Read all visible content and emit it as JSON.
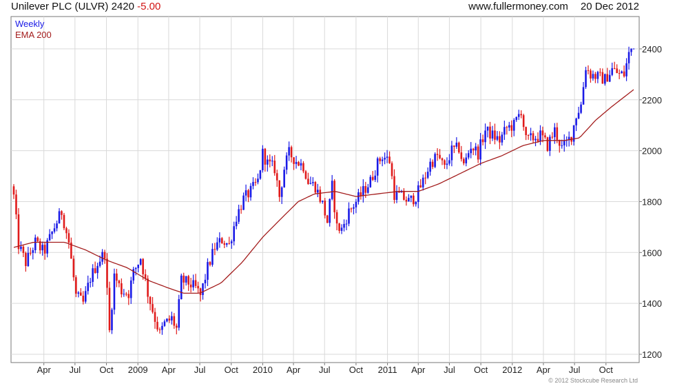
{
  "header": {
    "title": "Unilever PLC (ULVR) 2420",
    "change": "-5.00",
    "site": "www.fullermoney.com",
    "date": "20 Dec 2012"
  },
  "copyright": "© 2012 Stockcube Research Ltd",
  "colors": {
    "up": "#1a1ae6",
    "down": "#e01b1b",
    "ema": "#a31c1c",
    "grid": "#d9d9d9",
    "axis": "#777777"
  },
  "chart_data": {
    "type": "candlestick",
    "legend": [
      {
        "name": "Weekly",
        "color": "#1a1ae6"
      },
      {
        "name": "EMA 200",
        "color": "#a31c1c"
      }
    ],
    "y_axis": {
      "min": 1200,
      "max": 2500,
      "ticks": [
        1200,
        1400,
        1600,
        1800,
        2000,
        2200,
        2400
      ],
      "position": "right"
    },
    "x_axis": {
      "start": "2008-01-04",
      "end": "2012-12-21",
      "ticks": [
        {
          "label": "Apr",
          "date": "2008-04-01"
        },
        {
          "label": "Jul",
          "date": "2008-07-01"
        },
        {
          "label": "Oct",
          "date": "2008-10-01"
        },
        {
          "label": "2009",
          "date": "2009-01-01"
        },
        {
          "label": "Apr",
          "date": "2009-04-01"
        },
        {
          "label": "Jul",
          "date": "2009-07-01"
        },
        {
          "label": "Oct",
          "date": "2009-10-01"
        },
        {
          "label": "2010",
          "date": "2010-01-01"
        },
        {
          "label": "Apr",
          "date": "2010-04-01"
        },
        {
          "label": "Jul",
          "date": "2010-07-01"
        },
        {
          "label": "Oct",
          "date": "2010-10-01"
        },
        {
          "label": "2011",
          "date": "2011-01-01"
        },
        {
          "label": "Apr",
          "date": "2011-04-01"
        },
        {
          "label": "Jul",
          "date": "2011-07-01"
        },
        {
          "label": "Oct",
          "date": "2011-10-01"
        },
        {
          "label": "2012",
          "date": "2012-01-01"
        },
        {
          "label": "Apr",
          "date": "2012-04-01"
        },
        {
          "label": "Jul",
          "date": "2012-07-01"
        },
        {
          "label": "Oct",
          "date": "2012-10-01"
        }
      ]
    },
    "price_path": [
      [
        "2008-01-04",
        1820
      ],
      [
        "2008-01-18",
        1630
      ],
      [
        "2008-02-08",
        1560
      ],
      [
        "2008-03-07",
        1640
      ],
      [
        "2008-04-01",
        1600
      ],
      [
        "2008-05-02",
        1700
      ],
      [
        "2008-05-23",
        1760
      ],
      [
        "2008-06-13",
        1640
      ],
      [
        "2008-07-04",
        1430
      ],
      [
        "2008-07-25",
        1400
      ],
      [
        "2008-08-15",
        1500
      ],
      [
        "2008-09-05",
        1560
      ],
      [
        "2008-09-26",
        1600
      ],
      [
        "2008-10-10",
        1290
      ],
      [
        "2008-10-24",
        1510
      ],
      [
        "2008-11-14",
        1450
      ],
      [
        "2008-12-05",
        1440
      ],
      [
        "2008-12-19",
        1520
      ],
      [
        "2009-01-09",
        1580
      ],
      [
        "2009-01-30",
        1440
      ],
      [
        "2009-02-20",
        1340
      ],
      [
        "2009-03-06",
        1280
      ],
      [
        "2009-03-20",
        1320
      ],
      [
        "2009-04-10",
        1340
      ],
      [
        "2009-04-24",
        1300
      ],
      [
        "2009-05-08",
        1490
      ],
      [
        "2009-05-29",
        1480
      ],
      [
        "2009-06-19",
        1460
      ],
      [
        "2009-07-03",
        1430
      ],
      [
        "2009-07-24",
        1540
      ],
      [
        "2009-08-14",
        1620
      ],
      [
        "2009-09-04",
        1650
      ],
      [
        "2009-09-25",
        1630
      ],
      [
        "2009-10-16",
        1740
      ],
      [
        "2009-11-06",
        1810
      ],
      [
        "2009-11-27",
        1840
      ],
      [
        "2009-12-18",
        1880
      ],
      [
        "2010-01-01",
        1990
      ],
      [
        "2010-01-15",
        1950
      ],
      [
        "2010-02-05",
        1930
      ],
      [
        "2010-02-19",
        1820
      ],
      [
        "2010-03-05",
        1930
      ],
      [
        "2010-03-19",
        1990
      ],
      [
        "2010-04-09",
        1960
      ],
      [
        "2010-04-30",
        1940
      ],
      [
        "2010-05-14",
        1880
      ],
      [
        "2010-06-04",
        1860
      ],
      [
        "2010-06-25",
        1790
      ],
      [
        "2010-07-09",
        1720
      ],
      [
        "2010-07-23",
        1860
      ],
      [
        "2010-08-06",
        1700
      ],
      [
        "2010-08-20",
        1690
      ],
      [
        "2010-09-10",
        1760
      ],
      [
        "2010-10-01",
        1800
      ],
      [
        "2010-10-22",
        1840
      ],
      [
        "2010-11-12",
        1880
      ],
      [
        "2010-12-03",
        1950
      ],
      [
        "2010-12-17",
        1980
      ],
      [
        "2011-01-07",
        1960
      ],
      [
        "2011-01-21",
        1830
      ],
      [
        "2011-02-11",
        1820
      ],
      [
        "2011-03-04",
        1800
      ],
      [
        "2011-03-25",
        1820
      ],
      [
        "2011-04-15",
        1880
      ],
      [
        "2011-05-06",
        1950
      ],
      [
        "2011-05-27",
        1980
      ],
      [
        "2011-06-17",
        1930
      ],
      [
        "2011-07-08",
        2000
      ],
      [
        "2011-07-29",
        2010
      ],
      [
        "2011-08-12",
        1940
      ],
      [
        "2011-09-02",
        2020
      ],
      [
        "2011-09-23",
        1990
      ],
      [
        "2011-10-14",
        2080
      ],
      [
        "2011-11-04",
        2060
      ],
      [
        "2011-11-25",
        2040
      ],
      [
        "2011-12-16",
        2090
      ],
      [
        "2012-01-06",
        2100
      ],
      [
        "2012-01-27",
        2160
      ],
      [
        "2012-02-10",
        2040
      ],
      [
        "2012-03-02",
        2050
      ],
      [
        "2012-03-23",
        2060
      ],
      [
        "2012-04-13",
        2020
      ],
      [
        "2012-05-04",
        2080
      ],
      [
        "2012-05-25",
        2010
      ],
      [
        "2012-06-08",
        2030
      ],
      [
        "2012-06-22",
        2060
      ],
      [
        "2012-07-06",
        2140
      ],
      [
        "2012-07-20",
        2180
      ],
      [
        "2012-08-03",
        2330
      ],
      [
        "2012-08-17",
        2300
      ],
      [
        "2012-09-07",
        2290
      ],
      [
        "2012-09-28",
        2280
      ],
      [
        "2012-10-19",
        2320
      ],
      [
        "2012-11-09",
        2300
      ],
      [
        "2012-11-23",
        2300
      ],
      [
        "2012-12-07",
        2380
      ],
      [
        "2012-12-21",
        2420
      ]
    ],
    "ema_path": [
      [
        "2008-01-04",
        1620
      ],
      [
        "2008-03-01",
        1640
      ],
      [
        "2008-06-01",
        1640
      ],
      [
        "2008-08-01",
        1610
      ],
      [
        "2008-10-01",
        1570
      ],
      [
        "2008-12-01",
        1540
      ],
      [
        "2009-02-01",
        1490
      ],
      [
        "2009-04-01",
        1460
      ],
      [
        "2009-05-15",
        1440
      ],
      [
        "2009-07-01",
        1440
      ],
      [
        "2009-09-01",
        1480
      ],
      [
        "2009-11-01",
        1560
      ],
      [
        "2010-01-01",
        1660
      ],
      [
        "2010-03-01",
        1740
      ],
      [
        "2010-04-15",
        1800
      ],
      [
        "2010-06-01",
        1830
      ],
      [
        "2010-08-01",
        1840
      ],
      [
        "2010-10-01",
        1820
      ],
      [
        "2010-12-01",
        1830
      ],
      [
        "2011-02-01",
        1840
      ],
      [
        "2011-04-01",
        1840
      ],
      [
        "2011-06-01",
        1870
      ],
      [
        "2011-08-01",
        1910
      ],
      [
        "2011-10-01",
        1950
      ],
      [
        "2011-12-01",
        1980
      ],
      [
        "2012-02-01",
        2020
      ],
      [
        "2012-04-01",
        2040
      ],
      [
        "2012-06-01",
        2040
      ],
      [
        "2012-07-15",
        2050
      ],
      [
        "2012-09-01",
        2120
      ],
      [
        "2012-10-15",
        2170
      ],
      [
        "2012-12-21",
        2240
      ]
    ]
  }
}
